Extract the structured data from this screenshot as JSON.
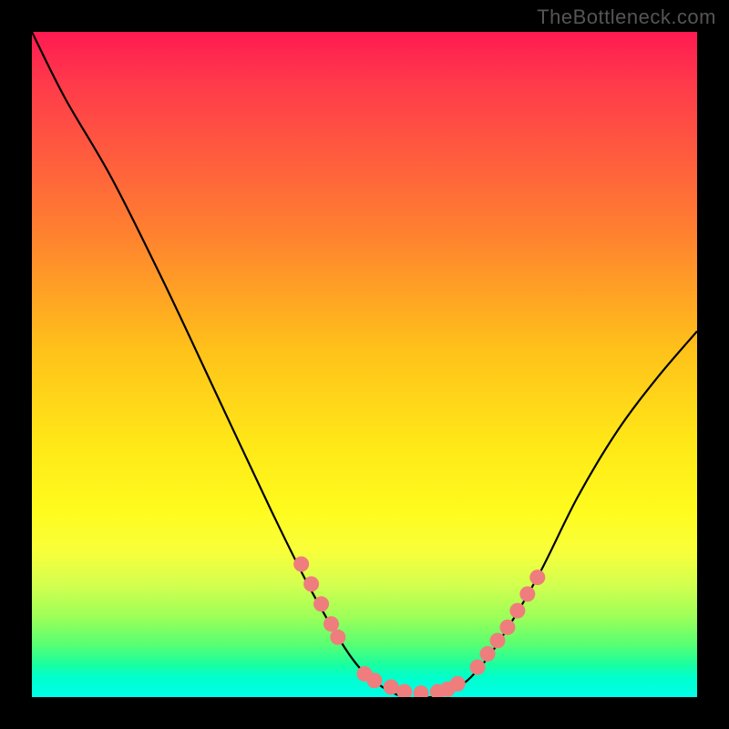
{
  "watermark": "TheBottleneck.com",
  "chart_data": {
    "type": "line",
    "title": "",
    "xlabel": "",
    "ylabel": "",
    "xlim": [
      0,
      100
    ],
    "ylim": [
      0,
      100
    ],
    "series": [
      {
        "name": "curve",
        "color": "#000000",
        "points": [
          {
            "x": 0,
            "y": 100
          },
          {
            "x": 5,
            "y": 90
          },
          {
            "x": 12,
            "y": 78
          },
          {
            "x": 20,
            "y": 62
          },
          {
            "x": 28,
            "y": 45
          },
          {
            "x": 36,
            "y": 28
          },
          {
            "x": 42,
            "y": 16
          },
          {
            "x": 48,
            "y": 6
          },
          {
            "x": 52,
            "y": 2
          },
          {
            "x": 56,
            "y": 0
          },
          {
            "x": 60,
            "y": 0
          },
          {
            "x": 63,
            "y": 1
          },
          {
            "x": 66,
            "y": 3
          },
          {
            "x": 70,
            "y": 8
          },
          {
            "x": 76,
            "y": 18
          },
          {
            "x": 82,
            "y": 30
          },
          {
            "x": 88,
            "y": 40
          },
          {
            "x": 94,
            "y": 48
          },
          {
            "x": 100,
            "y": 55
          }
        ]
      }
    ],
    "markers": [
      {
        "x": 40.5,
        "y": 20
      },
      {
        "x": 42,
        "y": 17
      },
      {
        "x": 43.5,
        "y": 14
      },
      {
        "x": 45,
        "y": 11
      },
      {
        "x": 46.0,
        "y": 9
      },
      {
        "x": 50,
        "y": 3.5
      },
      {
        "x": 51.5,
        "y": 2.5
      },
      {
        "x": 54,
        "y": 1.5
      },
      {
        "x": 56,
        "y": 0.8
      },
      {
        "x": 58.5,
        "y": 0.6
      },
      {
        "x": 61,
        "y": 0.8
      },
      {
        "x": 62.5,
        "y": 1.2
      },
      {
        "x": 64,
        "y": 2
      },
      {
        "x": 67,
        "y": 4.5
      },
      {
        "x": 68.5,
        "y": 6.5
      },
      {
        "x": 70,
        "y": 8.5
      },
      {
        "x": 71.5,
        "y": 10.5
      },
      {
        "x": 73,
        "y": 13
      },
      {
        "x": 74.5,
        "y": 15.5
      },
      {
        "x": 76,
        "y": 18
      }
    ],
    "marker_color": "#ef7d7d",
    "gradient_stops": [
      {
        "pos": 0,
        "color": "#ff1a52"
      },
      {
        "pos": 50,
        "color": "#ffe818"
      },
      {
        "pos": 100,
        "color": "#00ffe8"
      }
    ]
  }
}
